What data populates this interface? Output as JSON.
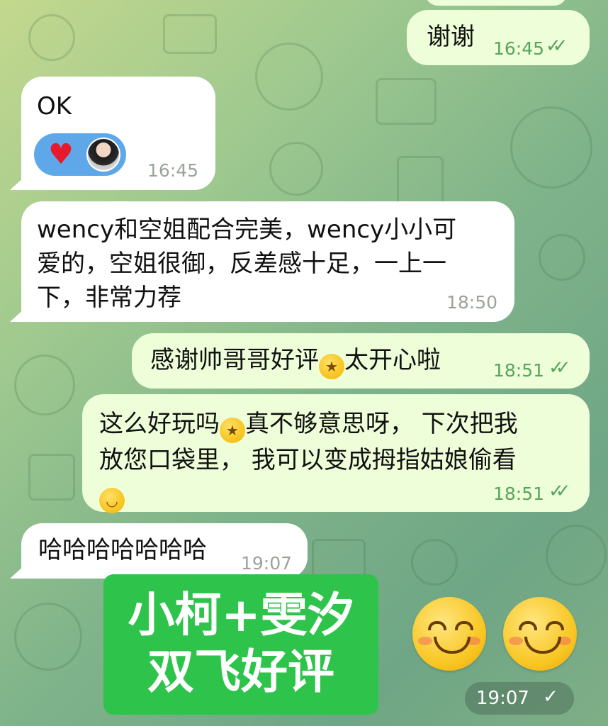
{
  "chat": {
    "messages": [
      {
        "side": "out",
        "text": "谢谢",
        "time": "16:45",
        "status": "read"
      },
      {
        "side": "in",
        "text": "OK",
        "time": "16:45",
        "reactions": [
          "heart-emoji",
          "user-avatar"
        ]
      },
      {
        "side": "in",
        "text": "wency和空姐配合完美，wency小小可爱的，空姐很御，反差感十足，一上一下，非常力荐",
        "lines": [
          "wency和空姐配合完美，wency小小可",
          "爱的，空姐很御，反差感十足，一上一",
          "下，非常力荐"
        ],
        "time": "18:50"
      },
      {
        "side": "out",
        "text_before": "感谢帅哥哥好评",
        "text_after": "太开心啦",
        "emoji": "star-struck-emoji",
        "time": "18:51",
        "status": "read"
      },
      {
        "side": "out",
        "lines": [
          "这么好玩吗",
          "真不够意思呀， 下次把我",
          "放您口袋里， 我可以变成拇指姑娘偷看"
        ],
        "emojis": [
          "star-struck-emoji",
          "grinning-sweat-emoji"
        ],
        "time": "18:51",
        "status": "read"
      },
      {
        "side": "in",
        "text": "哈哈哈哈哈哈哈",
        "time": "19:07"
      }
    ],
    "sticker": {
      "line1": "小柯+雯汐",
      "line2": "双飞好评",
      "time": "19:07",
      "status": "sent",
      "emojis": [
        "smiling-face-emoji",
        "smiling-face-emoji"
      ]
    }
  },
  "colors": {
    "incoming": "#ffffff",
    "outgoing": "#eefed9",
    "outgoing_time": "#57a55d",
    "sticker_green": "#2ec34a",
    "reaction_blue": "#5ea8e9"
  }
}
